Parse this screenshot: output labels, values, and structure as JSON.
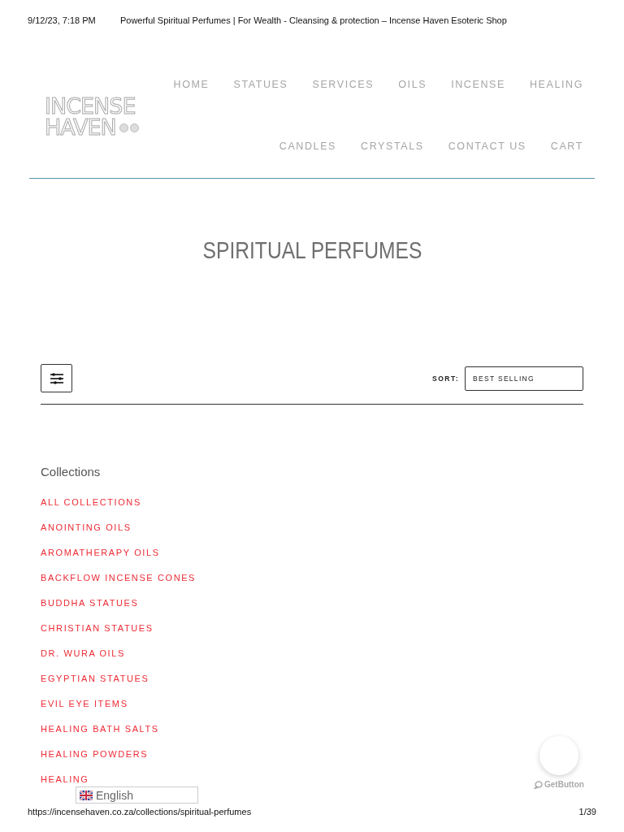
{
  "print_header": {
    "date": "9/12/23, 7:18 PM",
    "title": "Powerful Spiritual Perfumes | For Wealth - Cleansing & protection – Incense Haven Esoteric Shop"
  },
  "logo": {
    "lines": [
      "INCENSE",
      "HAVEN"
    ]
  },
  "nav_top": [
    "HOME",
    "STATUES",
    "SERVICES",
    "OILS",
    "INCENSE",
    "HEALING"
  ],
  "nav_bottom": [
    "CANDLES",
    "CRYSTALS",
    "CONTACT US",
    "CART"
  ],
  "page_title": "SPIRITUAL PERFUMES",
  "toolbar": {
    "sort_label": "SORT:",
    "sort_value": "BEST SELLING"
  },
  "collections": {
    "heading": "Collections",
    "items": [
      "ALL COLLECTIONS",
      "ANOINTING OILS",
      "AROMATHERAPY OILS",
      "BACKFLOW INCENSE CONES",
      "BUDDHA STATUES",
      "CHRISTIAN STATUES",
      "DR. WURA OILS",
      "EGYPTIAN STATUES",
      "EVIL EYE ITEMS",
      "HEALING BATH SALTS",
      "HEALING POWDERS",
      "HEALING"
    ]
  },
  "language_widget": {
    "label": "English"
  },
  "get_button": {
    "label": "GetButton"
  },
  "print_footer": {
    "url": "https://incensehaven.co.za/collections/spiritual-perfumes",
    "page": "1/39"
  }
}
